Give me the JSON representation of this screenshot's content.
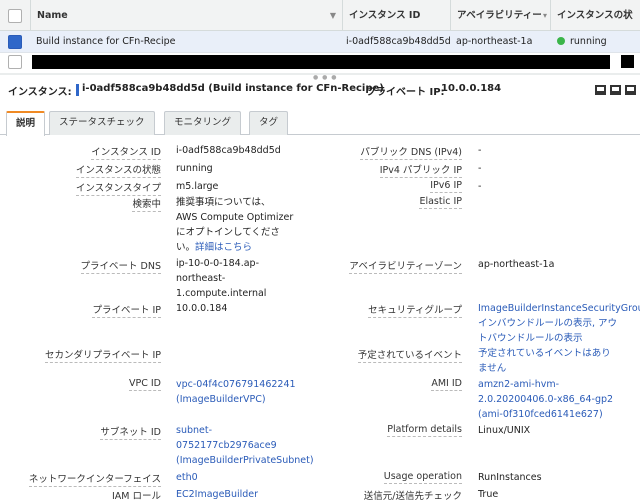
{
  "table": {
    "columns": [
      "Name",
      "インスタンス ID",
      "アベイラビリティー",
      "インスタンスの状"
    ],
    "row": {
      "name": "Build instance for CFn-Recipe",
      "instance_id": "i-0adf588ca9b48dd5d",
      "az": "ap-northeast-1a",
      "state": "running"
    }
  },
  "detail_header": {
    "instance_label": "インスタンス:",
    "instance_value": "i-0adf588ca9b48dd5d (Build instance for CFn-Recipe)",
    "private_ip_label": "プライベート IP:",
    "private_ip_value": "10.0.0.184"
  },
  "tabs": [
    "説明",
    "ステータスチェック",
    "モニタリング",
    "タグ"
  ],
  "details_left": {
    "instance_id": {
      "label": "インスタンス ID",
      "value": "i-0adf588ca9b48dd5d"
    },
    "state": {
      "label": "インスタンスの状態",
      "value": "running"
    },
    "type": {
      "label": "インスタンスタイプ",
      "value": "m5.large"
    },
    "finding": {
      "label": "検索中",
      "lines": [
        "推奨事項については、",
        "AWS Compute Optimizer",
        "にオプトインしてくださ",
        "い。"
      ],
      "link": "詳細はこちら"
    },
    "private_dns": {
      "label": "プライベート DNS",
      "lines": [
        "ip-10-0-0-184.ap-",
        "northeast-",
        "1.compute.internal"
      ]
    },
    "private_ip": {
      "label": "プライベート IP",
      "value": "10.0.0.184"
    },
    "secondary_ip": {
      "label": "セカンダリプライベート IP",
      "value": ""
    },
    "vpc": {
      "label": "VPC ID",
      "lines": [
        "vpc-04f4c076791462241",
        "(ImageBuilderVPC)"
      ]
    },
    "subnet": {
      "label": "サブネット ID",
      "lines": [
        "subnet-",
        "0752177cb2976ace9",
        "(ImageBuilderPrivateSubnet)"
      ]
    },
    "eni": {
      "label": "ネットワークインターフェイス",
      "value": "eth0"
    },
    "iam": {
      "label": "IAM ロール",
      "value": "EC2ImageBuilder"
    }
  },
  "details_right": {
    "public_dns": {
      "label": "パブリック DNS (IPv4)",
      "value": "-"
    },
    "public_ip": {
      "label": "IPv4 パブリック IP",
      "value": "-"
    },
    "ipv6": {
      "label": "IPv6 IP",
      "value": "-"
    },
    "elastic_ip": {
      "label": "Elastic IP",
      "value": ""
    },
    "az": {
      "label": "アベイラビリティーゾーン",
      "value": "ap-northeast-1a"
    },
    "sg": {
      "label": "セキュリティグループ",
      "lines": [
        "ImageBuilderInstanceSecurityGroup.",
        "インバウンドルールの表示, アウ",
        "トバウンドルールの表示"
      ]
    },
    "events": {
      "label": "予定されているイベント",
      "lines": [
        "予定されているイベントはあり",
        "ません"
      ]
    },
    "ami": {
      "label": "AMI ID",
      "lines": [
        "amzn2-ami-hvm-",
        "2.0.20200406.0-x86_64-gp2",
        "(ami-0f310fced6141e627)"
      ]
    },
    "platform": {
      "label": "Platform details",
      "value": "Linux/UNIX"
    },
    "usage": {
      "label": "Usage operation",
      "value": "RunInstances"
    },
    "src_dst": {
      "label": "送信元/送信先チェック",
      "value": "True"
    }
  }
}
